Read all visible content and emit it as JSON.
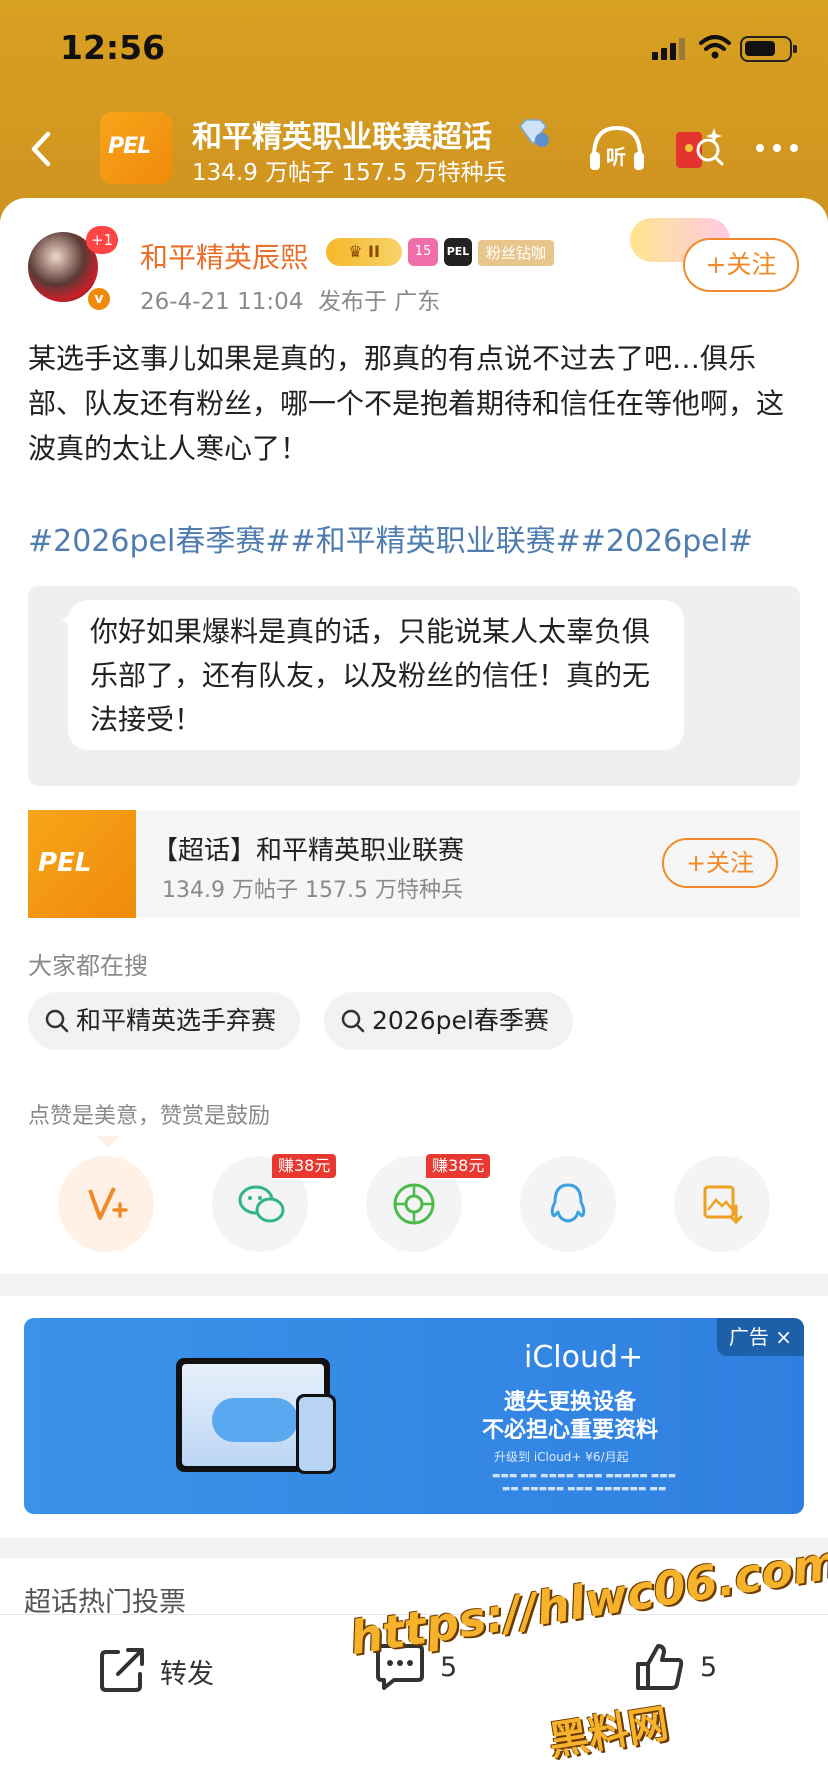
{
  "status": {
    "time": "12:56"
  },
  "header": {
    "logo_text": "PEL",
    "title": "和平精英职业联赛超话",
    "subtitle": "134.9 万帖子 157.5 万特种兵",
    "listen_icon": "listen-icon",
    "redpacket_icon": "red-packet-icon",
    "more_icon": "more-icon"
  },
  "post": {
    "avatar_badge": "+1",
    "username": "和平精英辰熙",
    "crown_level": "II",
    "level_badge": "15",
    "fan_badge": "粉丝钻咖",
    "time": "26-4-21 11:04",
    "location": "发布于 广东",
    "follow_label": "+关注",
    "body": "某选手这事儿如果是真的，那真的有点说不过去了吧…俱乐部、队友还有粉丝，哪一个不是抱着期待和信任在等他啊，这波真的太让人寒心了！",
    "tags": "#2026pel春季赛##和平精英职业联赛##2026pel#",
    "quote": "你好如果爆料是真的话，只能说某人太辜负俱乐部了，还有队友，以及粉丝的信任！真的无法接受！"
  },
  "topic": {
    "logo_text": "PEL",
    "title": "【超话】和平精英职业联赛",
    "subtitle": "134.9 万帖子 157.5 万特种兵",
    "follow_label": "+关注"
  },
  "search": {
    "label": "大家都在搜",
    "chips": [
      "和平精英选手弃赛",
      "2026pel春季赛"
    ]
  },
  "praise": {
    "label": "点赞是美意，赞赏是鼓励",
    "reward_badge_1": "赚38元",
    "reward_badge_2": "赚38元"
  },
  "ad": {
    "product": "iCloud+",
    "line1": "遗失更换设备",
    "line2": "不必担心重要资料",
    "line3": "升级到 iCloud+ ¥6/月起",
    "tag": "广告 ×"
  },
  "section": {
    "vote_title": "超话热门投票"
  },
  "bottom": {
    "forward_label": "转发",
    "comment_count": "5",
    "like_count": "5"
  },
  "watermark": {
    "line1": "https://hlwc06.com",
    "line2": "黑料网"
  },
  "colors": {
    "header_bg": "#d8a021",
    "accent": "#f08a2a",
    "tag_blue": "#507daf",
    "ad_blue": "#3a93e8"
  }
}
